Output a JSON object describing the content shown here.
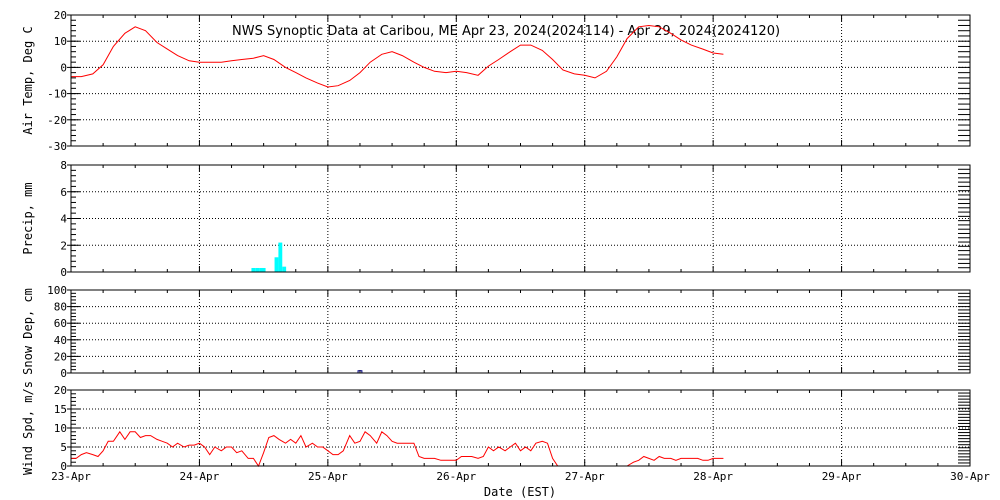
{
  "title": "NWS Synoptic Data at Caribou, ME   Apr 23, 2024(2024114) - Apr 29, 2024(2024120)",
  "x_axis": {
    "label": "Date (EST)",
    "ticks": [
      "23-Apr",
      "24-Apr",
      "25-Apr",
      "26-Apr",
      "27-Apr",
      "28-Apr",
      "29-Apr",
      "30-Apr"
    ],
    "range_days": [
      0,
      7
    ]
  },
  "colors": {
    "line": "#ff0000",
    "precip": "#00ffff",
    "snow": "#000080",
    "grid": "#000000"
  },
  "chart_data": [
    {
      "type": "line",
      "name": "air-temp",
      "ylabel": "Air Temp, Deg C",
      "ylim": [
        -30,
        20
      ],
      "yticks": [
        -30,
        -20,
        -10,
        0,
        10,
        20
      ],
      "grid": true,
      "x": [
        0.0,
        0.08,
        0.17,
        0.25,
        0.33,
        0.42,
        0.5,
        0.58,
        0.67,
        0.75,
        0.83,
        0.92,
        1.0,
        1.08,
        1.17,
        1.25,
        1.33,
        1.42,
        1.5,
        1.58,
        1.67,
        1.75,
        1.83,
        1.92,
        2.0,
        2.08,
        2.17,
        2.25,
        2.33,
        2.42,
        2.5,
        2.58,
        2.67,
        2.75,
        2.83,
        2.92,
        3.0,
        3.08,
        3.17,
        3.25,
        3.33,
        3.42,
        3.5,
        3.58,
        3.67,
        3.75,
        3.83,
        3.92,
        4.0,
        4.08,
        4.17,
        4.25,
        4.33,
        4.42,
        4.5,
        4.58,
        4.67,
        4.75,
        4.83,
        4.92,
        5.0,
        5.08
      ],
      "y": [
        -3.5,
        -3.5,
        -2.5,
        1.0,
        8.0,
        13.0,
        15.5,
        14.0,
        9.5,
        7.0,
        4.5,
        2.5,
        2.0,
        2.0,
        2.0,
        2.5,
        3.0,
        3.5,
        4.5,
        3.0,
        0.0,
        -2.0,
        -4.0,
        -6.0,
        -7.5,
        -7.0,
        -5.0,
        -2.0,
        2.0,
        5.0,
        6.0,
        4.5,
        2.0,
        0.0,
        -1.5,
        -2.0,
        -1.5,
        -2.0,
        -3.0,
        0.5,
        3.0,
        6.0,
        8.5,
        8.5,
        6.5,
        3.0,
        -1.0,
        -2.5,
        -3.0,
        -4.0,
        -1.5,
        4.0,
        11.0,
        15.5,
        16.0,
        15.5,
        13.0,
        10.5,
        8.5,
        7.0,
        5.5,
        5.0
      ]
    },
    {
      "type": "bar",
      "name": "precip",
      "ylabel": "Precip, mm",
      "ylim": [
        0,
        8
      ],
      "yticks": [
        0,
        2,
        4,
        6,
        8
      ],
      "grid": true,
      "x": [
        1.42,
        1.45,
        1.48,
        1.5,
        1.6,
        1.63,
        1.66
      ],
      "values": [
        0.3,
        0.3,
        0.3,
        0.3,
        1.1,
        2.2,
        0.4
      ],
      "bar_width_days": 0.03
    },
    {
      "type": "bar",
      "name": "snow-depth",
      "ylabel": "Snow Dep, cm",
      "ylim": [
        0,
        100
      ],
      "yticks": [
        0,
        20,
        40,
        60,
        80,
        100
      ],
      "grid": true,
      "x": [
        2.25
      ],
      "values": [
        1.5
      ],
      "bar_width_days": 0.03
    },
    {
      "type": "line",
      "name": "wind-speed",
      "ylabel": "Wind Spd, m/s",
      "ylim": [
        0,
        20
      ],
      "yticks": [
        0,
        5,
        10,
        15,
        20
      ],
      "grid": true,
      "segments": [
        {
          "x": [
            0.0,
            0.04,
            0.08,
            0.12,
            0.17,
            0.21,
            0.25,
            0.29,
            0.33,
            0.38,
            0.42,
            0.46,
            0.5,
            0.54,
            0.58,
            0.62,
            0.67,
            0.71,
            0.75,
            0.79,
            0.83,
            0.88,
            0.92,
            0.96,
            1.0,
            1.04,
            1.08,
            1.12,
            1.17,
            1.21,
            1.25,
            1.29,
            1.33,
            1.38,
            1.42,
            1.46,
            1.5,
            1.54,
            1.58,
            1.62,
            1.67,
            1.71,
            1.75,
            1.79,
            1.83,
            1.88,
            1.92,
            1.96,
            2.0,
            2.04,
            2.08,
            2.12,
            2.17,
            2.21,
            2.25,
            2.29,
            2.33,
            2.38,
            2.42,
            2.46,
            2.5,
            2.54,
            2.58,
            2.62,
            2.67,
            2.71,
            2.75,
            2.79,
            2.83,
            2.88,
            2.92,
            2.96,
            3.0,
            3.04,
            3.08,
            3.12,
            3.17,
            3.21,
            3.25,
            3.29,
            3.33,
            3.38,
            3.42,
            3.46,
            3.5,
            3.54,
            3.58,
            3.62,
            3.67,
            3.71,
            3.75,
            3.79,
            3.83,
            3.88
          ],
          "y": [
            2,
            2,
            3,
            3.5,
            3,
            2.5,
            4,
            6.5,
            6.5,
            9,
            7,
            9,
            9,
            7.5,
            8,
            8,
            7,
            6.5,
            6,
            5,
            6,
            5,
            5.5,
            5.5,
            6,
            5,
            3,
            5,
            4,
            5,
            5,
            3.5,
            4,
            2,
            2,
            0,
            3.5,
            7.5,
            8,
            7,
            6,
            7,
            6,
            8,
            5,
            6,
            5,
            5,
            4,
            3,
            3,
            4,
            8,
            6,
            6.5,
            9,
            8,
            6,
            9,
            8,
            6.5,
            6,
            6,
            6,
            6,
            2.5,
            2,
            2,
            2,
            1.5,
            1.5,
            1.5,
            1.5,
            2.5,
            2.5,
            2.5,
            2,
            2.5,
            5,
            4,
            5,
            4,
            5,
            6,
            4,
            5,
            4,
            6,
            6.5,
            6,
            2,
            0,
            0,
            0
          ]
        },
        {
          "x": [
            4.33,
            4.38,
            4.42,
            4.46,
            4.5,
            4.54,
            4.58,
            4.62,
            4.67,
            4.71,
            4.75,
            4.79,
            4.83,
            4.88,
            4.92,
            4.96,
            5.0,
            5.04,
            5.08
          ],
          "y": [
            0,
            1,
            1.5,
            2.5,
            2,
            1.5,
            2.5,
            2,
            2,
            1.5,
            2,
            2,
            2,
            2,
            1.5,
            1.5,
            2,
            2,
            2
          ]
        }
      ]
    }
  ]
}
